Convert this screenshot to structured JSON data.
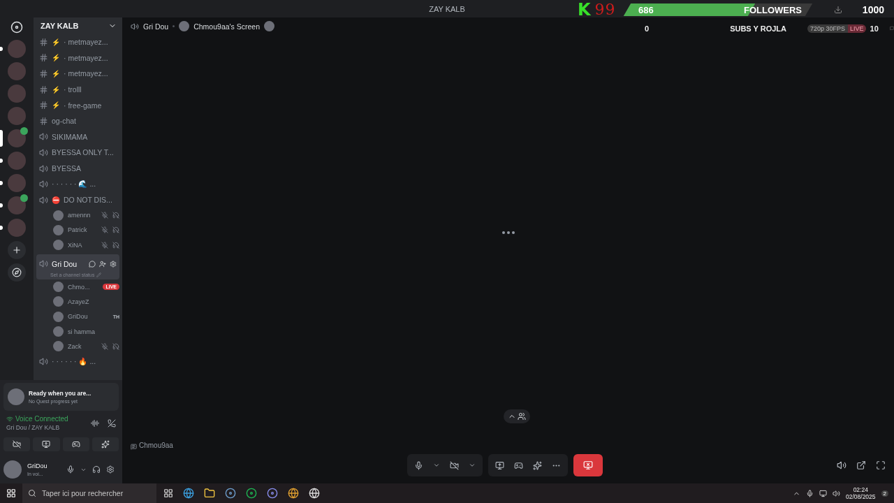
{
  "title_bar": {
    "title": "ZAY KALB"
  },
  "overlay": {
    "letter": "K",
    "score": "99",
    "followers_count": "686",
    "followers_label": "FOLLOWERS",
    "goal": "1000",
    "level": 0.686,
    "subs_count": "0",
    "subs_label": "SUBS Y ROJLA",
    "quality": "720p 30FPS",
    "live": "LIVE",
    "viewers": "10"
  },
  "servers": [
    {
      "selected": false,
      "unread": true,
      "speaking": false
    },
    {
      "selected": false,
      "unread": false,
      "speaking": false
    },
    {
      "selected": false,
      "unread": false,
      "speaking": false
    },
    {
      "selected": false,
      "unread": false,
      "speaking": false
    },
    {
      "selected": true,
      "speaking": true
    },
    {
      "selected": false,
      "unread": true,
      "speaking": false
    },
    {
      "selected": false,
      "unread": true,
      "speaking": false
    },
    {
      "selected": false,
      "unread": true,
      "speaking": true
    },
    {
      "selected": false,
      "unread": true,
      "speaking": false
    }
  ],
  "server": {
    "name": "ZAY KALB"
  },
  "channels": [
    {
      "kind": "text",
      "emoji": "⚡",
      "name": "· metmayez...",
      "selected": false
    },
    {
      "kind": "text",
      "emoji": "⚡",
      "name": "· metmayez...",
      "selected": false
    },
    {
      "kind": "text",
      "emoji": "⚡",
      "name": "· metmayez...",
      "selected": false
    },
    {
      "kind": "text",
      "emoji": "⚡",
      "name": "· trolll",
      "selected": false
    },
    {
      "kind": "text",
      "emoji": "⚡",
      "name": "· free-game",
      "selected": false
    },
    {
      "kind": "text",
      "name": "og-chat",
      "selected": false
    },
    {
      "kind": "voice",
      "name": "SIKIMAMA",
      "selected": false
    },
    {
      "kind": "voice",
      "name": "BYESSA ONLY T...",
      "selected": false
    },
    {
      "kind": "voice",
      "name": "BYESSA",
      "selected": false
    },
    {
      "kind": "voice",
      "name": "· · · · · · 🌊 ...",
      "selected": false
    },
    {
      "kind": "voice",
      "emoji": "⛔",
      "name": "DO NOT DIS...",
      "selected": false,
      "members": [
        {
          "name": "amennn",
          "muted": true,
          "deafened": true
        },
        {
          "name": "Patrick",
          "muted": true,
          "deafened": true
        },
        {
          "name": "XiNA",
          "muted": true,
          "deafened": true
        }
      ]
    },
    {
      "kind": "voice",
      "name": "Gri Dou",
      "selected": true,
      "status": "Set a channel status",
      "members": [
        {
          "name": "Chmo...",
          "live": "LIVE",
          "muted": false,
          "deafened": false
        },
        {
          "name": "AzayeZ",
          "muted": false,
          "deafened": false
        },
        {
          "name": "GriDou",
          "tag": "TH",
          "muted": false,
          "deafened": false
        },
        {
          "name": "si hamma",
          "muted": false,
          "deafened": false
        },
        {
          "name": "Zack",
          "muted": true,
          "deafened": true
        }
      ]
    },
    {
      "kind": "voice",
      "name": "· · · · · · 🔥 ...",
      "selected": false
    }
  ],
  "quest": {
    "title": "Ready when you are...",
    "subtitle": "No Quest progress yet"
  },
  "voice": {
    "status": "Voice Connected",
    "location": "Gri Dou / ZAY KALB"
  },
  "user": {
    "name": "GriDou",
    "status": "In voi..."
  },
  "header": {
    "channel": "Gri Dou",
    "stream": "Chmou9aa's Screen"
  },
  "stream": {
    "label": "Chmou9aa"
  },
  "taskbar": {
    "search": "Taper ici pour rechercher",
    "time": "02:24",
    "date": "02/08/2025",
    "notifications": "2"
  }
}
